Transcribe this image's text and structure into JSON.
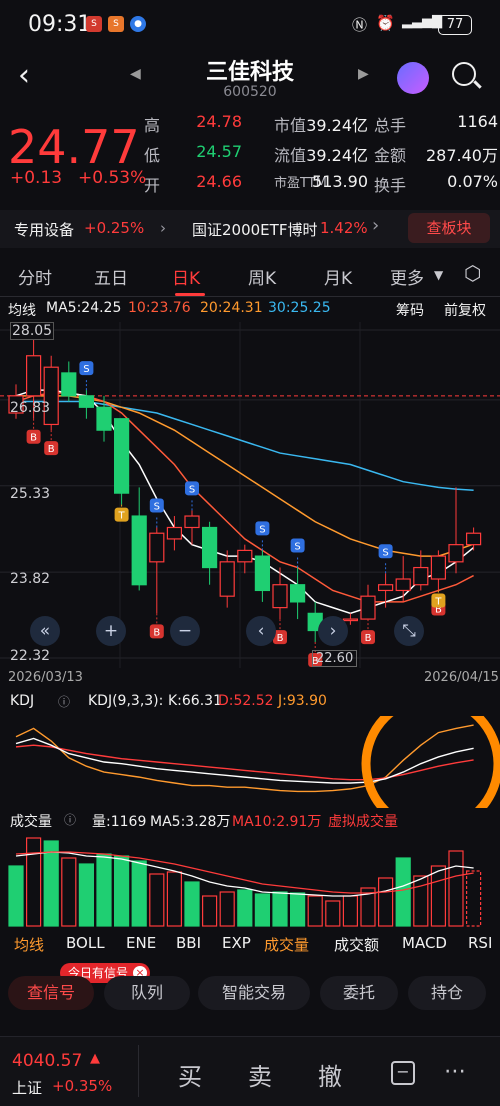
{
  "status": {
    "time": "09:31",
    "battery": "77"
  },
  "nav": {
    "title": "三佳科技",
    "code": "600520"
  },
  "quote": {
    "price": "24.77",
    "change": "+0.13",
    "change_pct": "+0.53%",
    "rows": [
      [
        {
          "l": "高",
          "v": "24.78",
          "c": "red"
        },
        {
          "l": "市值",
          "v": "39.24亿",
          "c": "white"
        },
        {
          "l": "总手",
          "v": "1164",
          "c": "white"
        }
      ],
      [
        {
          "l": "低",
          "v": "24.57",
          "c": "green"
        },
        {
          "l": "流值",
          "v": "39.24亿",
          "c": "white"
        },
        {
          "l": "金额",
          "v": "287.40万",
          "c": "white"
        }
      ],
      [
        {
          "l": "开",
          "v": "24.66",
          "c": "red"
        },
        {
          "l": "市盈TTM",
          "v": "513.90",
          "c": "white"
        },
        {
          "l": "换手",
          "v": "0.07%",
          "c": "white"
        }
      ]
    ]
  },
  "industry": {
    "sector": "专用设备",
    "sector_chg": "+0.25%",
    "etf": "国证2000ETF博时",
    "etf_chg": "1.42%",
    "btn": "查板块"
  },
  "tabs": [
    "分时",
    "五日",
    "日K",
    "周K",
    "月K",
    "更多"
  ],
  "ma_row": {
    "label": "均线",
    "ma5": "MA5:24.25",
    "ma10": "10:23.76",
    "ma20": "20:24.31",
    "ma30": "30:25.25",
    "chips": "筹码",
    "adj": "前复权"
  },
  "chart_data": {
    "type": "candlestick",
    "y_ticks": [
      "28.05",
      "26.83",
      "25.33",
      "23.82",
      "22.32"
    ],
    "y_axis": [
      28.05,
      26.83,
      25.33,
      23.82,
      22.32
    ],
    "ylim": [
      22.32,
      28.05
    ],
    "ref_line": 26.9,
    "dates": [
      "2026/03/13",
      "2026/04/15"
    ],
    "candles": [
      {
        "o": 26.6,
        "c": 26.9,
        "h": 27.1,
        "l": 26.5
      },
      {
        "o": 26.9,
        "c": 27.6,
        "h": 28.05,
        "l": 26.5
      },
      {
        "o": 26.4,
        "c": 27.4,
        "h": 27.6,
        "l": 26.3
      },
      {
        "o": 27.3,
        "c": 26.9,
        "h": 27.5,
        "l": 26.8
      },
      {
        "o": 26.9,
        "c": 26.7,
        "h": 27.0,
        "l": 26.5
      },
      {
        "o": 26.7,
        "c": 26.3,
        "h": 26.9,
        "l": 26.1
      },
      {
        "o": 26.5,
        "c": 25.2,
        "h": 26.5,
        "l": 25.0
      },
      {
        "o": 24.8,
        "c": 23.6,
        "h": 25.3,
        "l": 23.5
      },
      {
        "o": 24.0,
        "c": 24.5,
        "h": 24.6,
        "l": 23.1
      },
      {
        "o": 24.4,
        "c": 24.6,
        "h": 24.8,
        "l": 24.2
      },
      {
        "o": 24.6,
        "c": 24.8,
        "h": 24.9,
        "l": 24.3
      },
      {
        "o": 24.6,
        "c": 23.9,
        "h": 24.7,
        "l": 23.6
      },
      {
        "o": 23.4,
        "c": 24.0,
        "h": 24.2,
        "l": 23.2
      },
      {
        "o": 24.0,
        "c": 24.2,
        "h": 24.3,
        "l": 23.8
      },
      {
        "o": 24.1,
        "c": 23.5,
        "h": 24.2,
        "l": 23.3
      },
      {
        "o": 23.2,
        "c": 23.6,
        "h": 23.9,
        "l": 23.0
      },
      {
        "o": 23.6,
        "c": 23.3,
        "h": 23.9,
        "l": 23.0
      },
      {
        "o": 23.1,
        "c": 22.8,
        "h": 23.3,
        "l": 22.6
      },
      {
        "o": 22.7,
        "c": 22.9,
        "h": 23.0,
        "l": 22.6
      },
      {
        "o": 23.0,
        "c": 23.0,
        "h": 23.1,
        "l": 22.9
      },
      {
        "o": 23.0,
        "c": 23.4,
        "h": 23.6,
        "l": 23.0
      },
      {
        "o": 23.5,
        "c": 23.6,
        "h": 23.8,
        "l": 23.2
      },
      {
        "o": 23.5,
        "c": 23.7,
        "h": 24.1,
        "l": 23.3
      },
      {
        "o": 23.6,
        "c": 23.9,
        "h": 24.2,
        "l": 23.5
      },
      {
        "o": 23.7,
        "c": 24.1,
        "h": 24.2,
        "l": 23.5
      },
      {
        "o": 24.0,
        "c": 24.3,
        "h": 25.3,
        "l": 23.8
      },
      {
        "o": 24.3,
        "c": 24.5,
        "h": 24.6,
        "l": 24.2
      }
    ],
    "ma5": [
      26.9,
      27.0,
      27.0,
      26.95,
      26.9,
      26.6,
      26.1,
      25.7,
      25.1,
      24.6,
      24.3,
      24.2,
      24.1,
      24.1,
      24.0,
      23.8,
      23.6,
      23.3,
      23.2,
      23.1,
      23.2,
      23.3,
      23.4,
      23.7,
      23.8,
      24.0,
      24.25
    ],
    "ma10": [
      26.8,
      26.9,
      26.95,
      26.95,
      26.9,
      26.8,
      26.6,
      26.3,
      26.0,
      25.7,
      25.3,
      25.0,
      24.7,
      24.4,
      24.2,
      24.0,
      23.9,
      23.7,
      23.5,
      23.4,
      23.3,
      23.3,
      23.3,
      23.4,
      23.5,
      23.6,
      23.76
    ],
    "ma20": [
      26.9,
      26.9,
      26.9,
      26.9,
      26.85,
      26.8,
      26.7,
      26.6,
      26.45,
      26.3,
      26.1,
      25.9,
      25.7,
      25.5,
      25.3,
      25.1,
      24.9,
      24.7,
      24.55,
      24.4,
      24.3,
      24.2,
      24.15,
      24.1,
      24.1,
      24.2,
      24.31
    ],
    "ma30": [
      26.8,
      26.8,
      26.8,
      26.8,
      26.8,
      26.75,
      26.7,
      26.65,
      26.6,
      26.5,
      26.4,
      26.3,
      26.2,
      26.1,
      26.0,
      25.9,
      25.85,
      25.8,
      25.75,
      25.7,
      25.6,
      25.5,
      25.4,
      25.35,
      25.3,
      25.27,
      25.25
    ],
    "signals": [
      {
        "i": 1,
        "t": "B"
      },
      {
        "i": 2,
        "t": "B"
      },
      {
        "i": 4,
        "t": "S"
      },
      {
        "i": 6,
        "t": "T"
      },
      {
        "i": 8,
        "t": "B"
      },
      {
        "i": 8,
        "t": "S"
      },
      {
        "i": 10,
        "t": "S"
      },
      {
        "i": 14,
        "t": "S"
      },
      {
        "i": 15,
        "t": "B"
      },
      {
        "i": 16,
        "t": "S"
      },
      {
        "i": 17,
        "t": "B"
      },
      {
        "i": 20,
        "t": "B"
      },
      {
        "i": 21,
        "t": "S"
      },
      {
        "i": 24,
        "t": "B"
      },
      {
        "i": 24,
        "t": "T"
      }
    ],
    "last_low_label": "22.60"
  },
  "kdj": {
    "label": "KDJ",
    "params": "KDJ(9,3,3):",
    "k": "K:66.31",
    "d": "D:52.52",
    "j": "J:93.90",
    "k_vals": [
      72,
      78,
      70,
      60,
      55,
      50,
      48,
      45,
      42,
      40,
      38,
      36,
      34,
      32,
      30,
      28,
      27,
      26,
      25,
      25,
      26,
      30,
      38,
      48,
      56,
      62,
      66.31
    ],
    "d_vals": [
      68,
      70,
      68,
      64,
      60,
      57,
      54,
      52,
      50,
      48,
      46,
      44,
      42,
      40,
      38,
      36,
      34,
      32,
      30,
      29,
      29,
      31,
      35,
      40,
      45,
      49,
      52.52
    ],
    "j_vals": [
      80,
      90,
      75,
      55,
      45,
      38,
      35,
      32,
      28,
      25,
      22,
      22,
      20,
      20,
      18,
      16,
      15,
      15,
      16,
      18,
      22,
      32,
      52,
      70,
      85,
      90,
      93.9
    ]
  },
  "vol": {
    "label": "成交量",
    "qty": "量:1169",
    "ma5": "MA5:3.28万",
    "ma10": "MA10:2.91万",
    "virt": "虚拟成交量",
    "bars": [
      {
        "v": 60,
        "r": false
      },
      {
        "v": 88,
        "r": true
      },
      {
        "v": 85,
        "r": false
      },
      {
        "v": 68,
        "r": true
      },
      {
        "v": 62,
        "r": false
      },
      {
        "v": 72,
        "r": false
      },
      {
        "v": 70,
        "r": false
      },
      {
        "v": 65,
        "r": false
      },
      {
        "v": 52,
        "r": true
      },
      {
        "v": 54,
        "r": true
      },
      {
        "v": 44,
        "r": false
      },
      {
        "v": 30,
        "r": true
      },
      {
        "v": 34,
        "r": true
      },
      {
        "v": 36,
        "r": false
      },
      {
        "v": 32,
        "r": false
      },
      {
        "v": 34,
        "r": false
      },
      {
        "v": 33,
        "r": false
      },
      {
        "v": 30,
        "r": true
      },
      {
        "v": 25,
        "r": true
      },
      {
        "v": 30,
        "r": true
      },
      {
        "v": 38,
        "r": true
      },
      {
        "v": 48,
        "r": true
      },
      {
        "v": 68,
        "r": false
      },
      {
        "v": 50,
        "r": true
      },
      {
        "v": 60,
        "r": true
      },
      {
        "v": 75,
        "r": true
      },
      {
        "v": 55,
        "r": true
      }
    ],
    "ma5_vals": [
      70,
      72,
      74,
      73,
      70,
      69,
      67,
      63,
      59,
      55,
      50,
      44,
      40,
      38,
      34,
      33,
      32,
      31,
      30,
      30,
      32,
      35,
      40,
      47,
      55,
      60,
      58
    ],
    "ma10_vals": [
      72,
      73,
      74,
      74,
      73,
      72,
      70,
      68,
      65,
      62,
      58,
      54,
      50,
      46,
      42,
      40,
      38,
      36,
      34,
      33,
      33,
      34,
      36,
      40,
      45,
      50,
      53
    ]
  },
  "indicator_tabs": [
    "均线",
    "BOLL",
    "ENE",
    "BBI",
    "EXP",
    "成交量",
    "成交额",
    "MACD",
    "RSI"
  ],
  "bottom": {
    "signal_badge": "今日有信号",
    "check": "查信号",
    "queue": "队列",
    "smart": "智能交易",
    "order": "委托",
    "hold": "持仓"
  },
  "footer": {
    "index_val": "4040.57",
    "index_name": "上证",
    "index_chg": "+0.35%",
    "buy": "买",
    "sell": "卖",
    "cancel": "撤"
  },
  "colors": {
    "up": "#ff3b3b",
    "down": "#1fcf72",
    "ma5": "#ffffff",
    "ma10": "#ff5a3a",
    "ma20": "#ff9a2e",
    "ma30": "#3ab8f0"
  }
}
